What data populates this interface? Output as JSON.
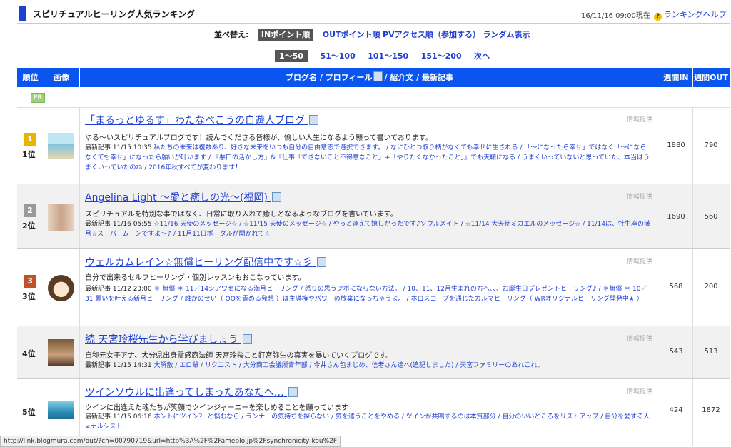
{
  "header": {
    "title": "スピリチュアルヒーリング人気ランキング",
    "timestamp": "16/11/16 09:00現在",
    "help_icon": "?",
    "help_label": "ランキングヘルプ"
  },
  "sort": {
    "label": "並べ替え:",
    "options": [
      "INポイント順",
      "OUTポイント順",
      "PVアクセス順（参加する）",
      "ランダム表示"
    ]
  },
  "pager": [
    "1〜50",
    "51〜100",
    "101〜150",
    "151〜200",
    "次へ"
  ],
  "table": {
    "headers": [
      "順位",
      "画像",
      "ブログ名 / プロフィール",
      "/ 紹介文 / 最新記事",
      "週間IN",
      "週間OUT"
    ],
    "pr": "PR",
    "provided": "情報提供",
    "recent_label": "最新記事",
    "rows": [
      {
        "rank": "1位",
        "medal": "1",
        "title": "「まるっとゆるす」わたなべこうの自遊人ブログ",
        "intro": "ゆる〜いスピリチュアルブログです！読んでくださる皆様が、愉しい人生になるよう願って書いております。",
        "date": "11/15 10:35",
        "recent": "私たちの未来は複数あり、好きな未来をいつも自分の自由意志で選択できます。 / なにひとつ取り柄がなくても幸せに生きれる / 「〜になったら幸せ」ではなく「〜にならなくても幸せ」になったら願いが叶います / 『悪口の活かし方』&『仕事「できないこと不得意なこと」+「やりたくなかったこと」』でも天職になる / うまくいっていないと思っていた、本当はうまくいっていたのね / 2016年秋すべてが変わります！",
        "in": "1880",
        "out": "790"
      },
      {
        "rank": "2位",
        "medal": "2",
        "title": "Angelina Light 〜愛と癒しの光〜(福岡)",
        "intro": "スピリチュアルを特別な事ではなく、日常に取り入れて癒しとなるようなブログを書いています。",
        "date": "11/16 05:55",
        "recent": "☆11/16 天使のメッセージ☆ / ☆11/15 天使のメッセージ☆ / やっと逢えて嬉しかったです♪ソウルメイト / ☆11/14 大天使ミカエルのメッセージ☆ / 11/14は、牡牛座の満月☆スーパームーンですよ〜♪ / 11月11日ポータルが開かれて☆",
        "in": "1690",
        "out": "560"
      },
      {
        "rank": "3位",
        "medal": "3",
        "title": "ウェルカムレイン☆無償ヒーリング配信中です☆彡",
        "intro": "自分で出来るセルフヒーリング・個別レッスンもおこなっています。",
        "date": "11/12 23:00",
        "recent": "＊ 無償 ＊ 11／14シアワセになる満月ヒーリング / 怒りの思うツボにならない方法。 / 10、11、12月生まれの方へ、、、お誕生日プレゼントヒーリング♪ / ＊無償 ＊ 10／31 願いを叶える新月ヒーリング / 誰かのせい（ OOを責める発想 ）は主導権やパワーの放棄になっちゃうよ。 / ホロスコープを通じたカルマヒーリング（ WRオリジナルヒーリング開発中★ ）",
        "in": "568",
        "out": "200"
      },
      {
        "rank": "4位",
        "medal": "",
        "title": "続 天宮玲桜先生から学びましょう",
        "intro": "自称元女子アナ、大分県出身霊感商法師 天宮玲桜こと釘宮弥生の真実を暴いていくブログです。",
        "date": "11/15 14:31",
        "recent": "大解散 / エロ爺 / リクエスト / 大分商工会議所青年部 / 今井さん包まじめ、信者さん達へ(追記しました) / 天宮ファミリーのあれこれ。",
        "in": "543",
        "out": "513"
      },
      {
        "rank": "5位",
        "medal": "",
        "title": "ツインソウルに出逢ってしまったあなたへ…",
        "intro": "ツインに出逢えた魂たちが笑顔でツインジャーニーを楽しめることを願っています",
        "date": "11/15 06:16",
        "recent": "ホントにツイン？ と悩むなら / ランナーの気持ちを探らない / 気を遣うことをやめる / ツインが共鳴するのは本質部分 / 自分のいいところをリストアップ / 自分を愛する人≠ナルシスト",
        "in": "424",
        "out": "1872"
      }
    ]
  },
  "status_url": "http://link.blogmura.com/out/?ch=00790719&url=http%3A%2F%2Fameblo.jp%2Fsynchronicity-kou%2F",
  "colors": {
    "accent": "#1f3fd1",
    "header_bg": "#0a55f0",
    "gold": "#e8b400",
    "silver": "#9a9a9a",
    "bronze": "#c0522a"
  }
}
